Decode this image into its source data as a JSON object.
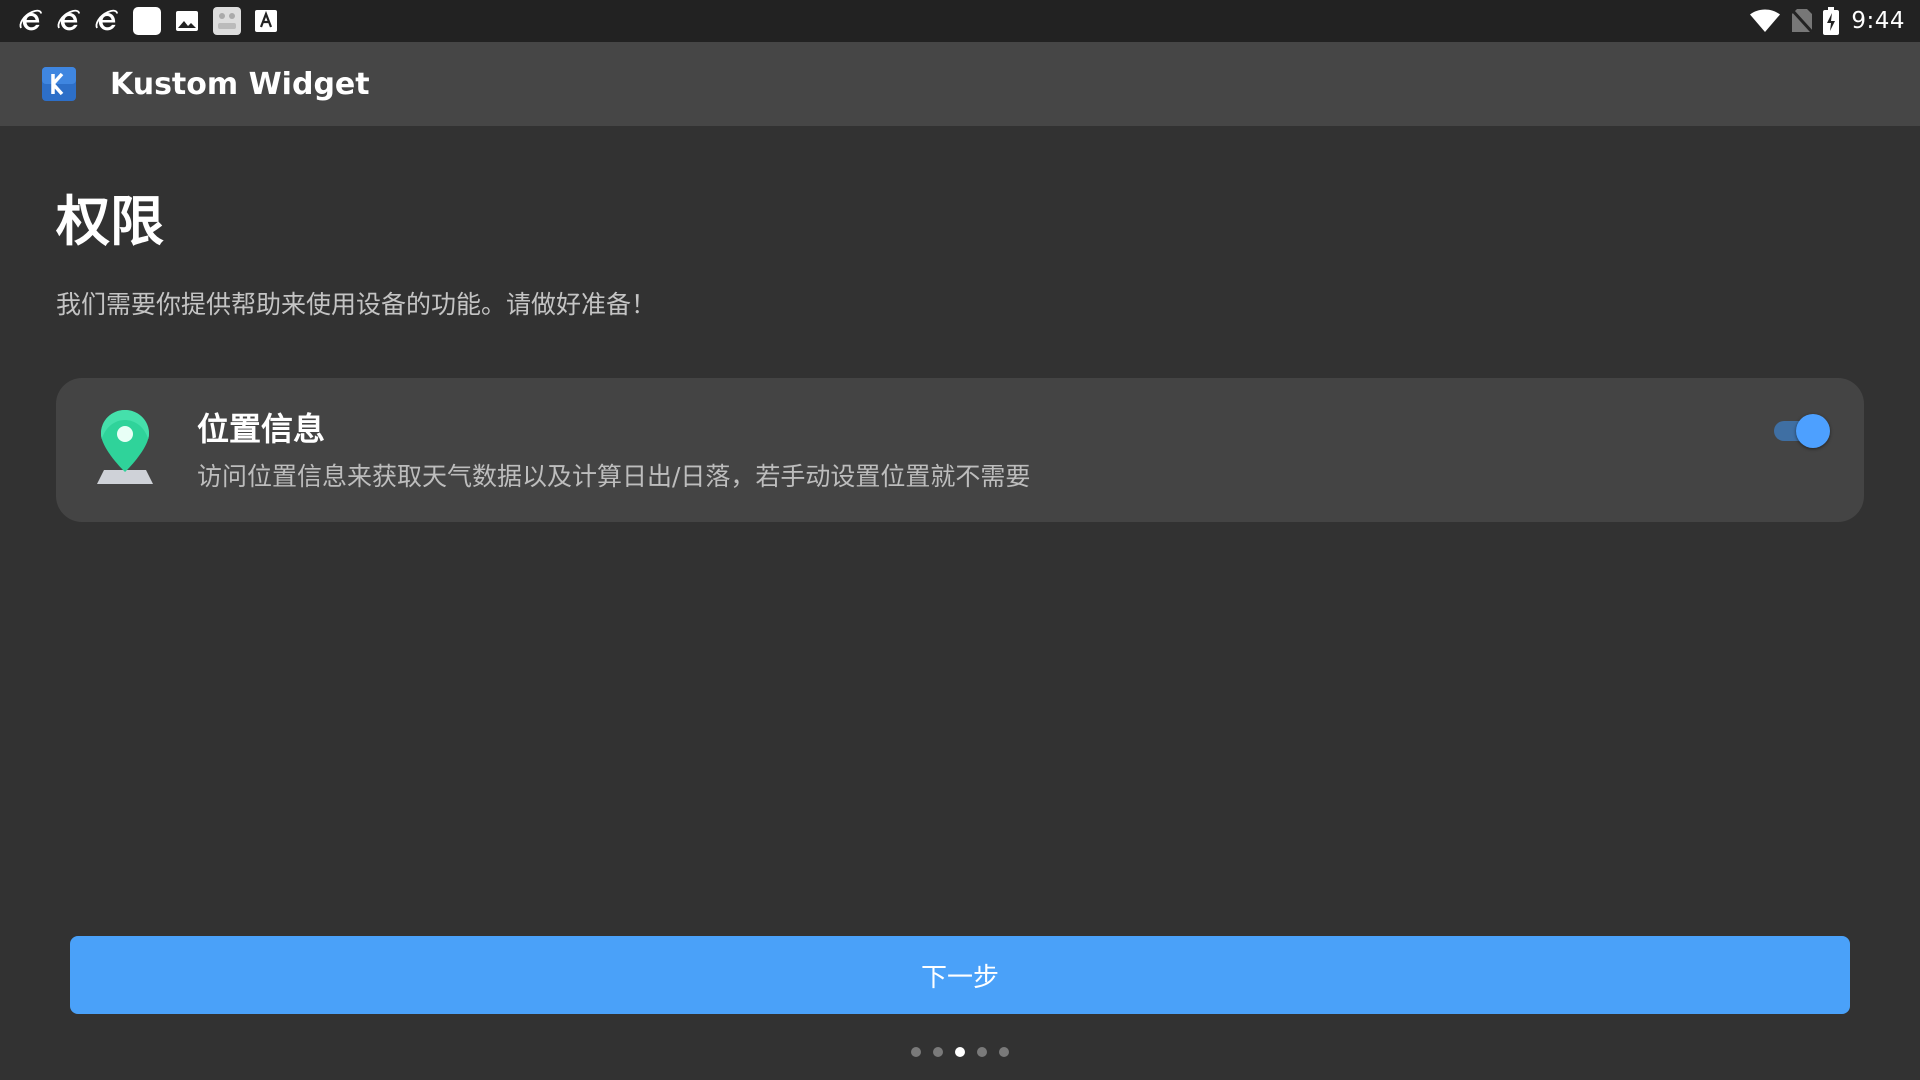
{
  "status_bar": {
    "left_icons": [
      "ie-browser-icon",
      "ie-browser-icon",
      "ie-browser-icon",
      "blank-app-icon",
      "image-icon",
      "gallery-icon",
      "font-icon"
    ],
    "right_icons": [
      "wifi-icon",
      "no-sim-icon",
      "battery-charging-icon"
    ],
    "time": "9:44"
  },
  "toolbar": {
    "app_icon": "kustom-k-icon",
    "title": "Kustom Widget"
  },
  "page": {
    "title": "权限",
    "subtitle": "我们需要你提供帮助来使用设备的功能。请做好准备！"
  },
  "permission": {
    "icon": "location-pin-icon",
    "title": "位置信息",
    "description": "访问位置信息来获取天气数据以及计算日出/日落，若手动设置位置就不需要",
    "enabled": true
  },
  "next_button": {
    "label": "下一步"
  },
  "pager": {
    "total": 5,
    "current": 3
  },
  "colors": {
    "background": "#323232",
    "toolbar": "#464646",
    "status_bar": "#222222",
    "card": "#444444",
    "accent": "#4aa1f9",
    "pin_green": "#2fd39a"
  }
}
